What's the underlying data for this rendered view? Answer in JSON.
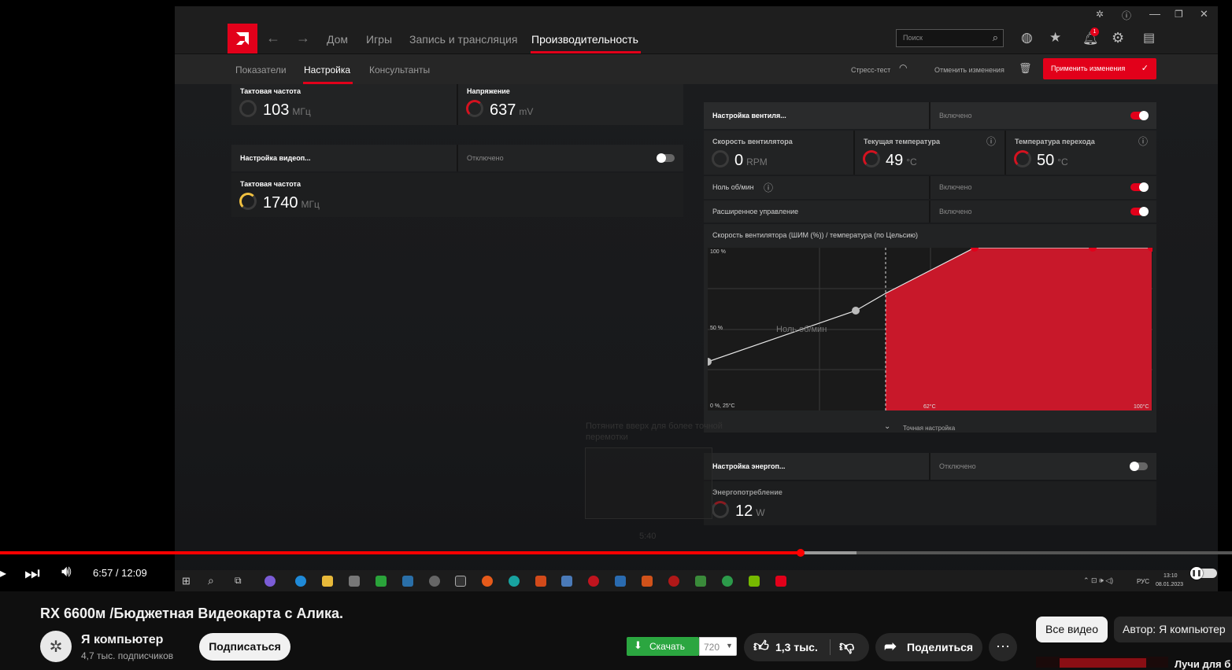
{
  "amd": {
    "nav": {
      "home": "Дом",
      "games": "Игры",
      "record": "Запись и трансляция",
      "performance": "Производительность"
    },
    "subnav": {
      "metrics": "Показатели",
      "tuning": "Настройка",
      "advisors": "Консультанты"
    },
    "search_placeholder": "Поиск",
    "notification_count": "1",
    "stress_test": "Стресс-тест",
    "discard": "Отменить изменения",
    "apply": "Применить изменения",
    "left_top": {
      "clock_label": "Тактовая частота",
      "clock_value": "103",
      "clock_unit": "МГц",
      "voltage_label": "Напряжение",
      "voltage_value": "637",
      "voltage_unit": "mV"
    },
    "video_tuning": {
      "title": "Настройка видеоп...",
      "status": "Отключено",
      "clock_label": "Тактовая частота",
      "clock_value": "1740",
      "clock_unit": "МГц"
    },
    "fan": {
      "title": "Настройка вентиля...",
      "status": "Включено",
      "speed_label": "Скорость вентилятора",
      "speed_value": "0",
      "speed_unit": "RPM",
      "temp_label": "Текущая температура",
      "temp_value": "49",
      "temp_unit": "°C",
      "junction_label": "Температура перехода",
      "junction_value": "50",
      "junction_unit": "°C",
      "zero_rpm_label": "Ноль об/мин",
      "zero_rpm_status": "Включено",
      "advanced_label": "Расширенное управление",
      "advanced_status": "Включено",
      "curve_title": "Скорость вентилятора (ШИМ (%)) / температура (по Цельсию)",
      "y_top": "100 %",
      "y_mid": "50 %",
      "origin": "0 %, 25°C",
      "x_mid": "62°C",
      "x_max": "100°C",
      "zero_rpm_area": "Ноль об/мин",
      "fine_tune": "Точная настройка"
    },
    "power": {
      "title": "Настройка энергоп...",
      "status": "Отключено",
      "label": "Энергопотребление",
      "value": "12",
      "unit": "W"
    },
    "taskbar": {
      "lang": "РУС",
      "time": "13:10",
      "date": "08.01.2023"
    }
  },
  "overlay": {
    "hint": "Потяните вверх для более точной перемотки",
    "time": "5:40"
  },
  "player": {
    "time": "6:57 / 12:09",
    "progress": 0.575
  },
  "video": {
    "title": "RX 6600м /Бюджетная Видеокарта с Алика.",
    "channel": "Я компьютер",
    "subs": "4,7 тыс. подписчиков",
    "subscribe": "Подписаться",
    "download": "Скачать",
    "quality": "720",
    "likes": "1,3 тыс.",
    "share": "Поделиться"
  },
  "sidebar": {
    "all_videos": "Все видео",
    "by_author": "Автор: Я компьютер",
    "next_title": "Лучи для б"
  },
  "colors": {
    "amd_red": "#e2001a",
    "yt_red": "#ff0000",
    "download_green": "#2ba640"
  }
}
